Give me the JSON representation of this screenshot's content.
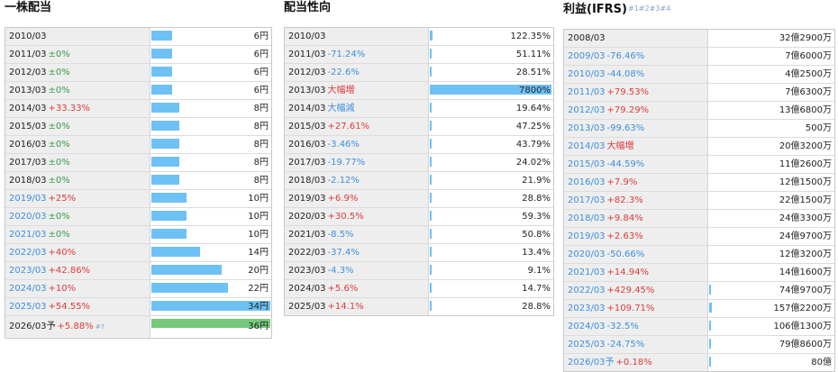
{
  "panels": [
    {
      "title": "一株配当",
      "title_sup": "",
      "rows": [
        {
          "year": "2010/03",
          "change": "",
          "sign": "",
          "value": "6円",
          "fill": 0.176,
          "highlight": false
        },
        {
          "year": "2011/03",
          "change": "±0%",
          "sign": "zero",
          "value": "6円",
          "fill": 0.176,
          "highlight": false
        },
        {
          "year": "2012/03",
          "change": "±0%",
          "sign": "zero",
          "value": "6円",
          "fill": 0.176,
          "highlight": false
        },
        {
          "year": "2013/03",
          "change": "±0%",
          "sign": "zero",
          "value": "6円",
          "fill": 0.176,
          "highlight": false
        },
        {
          "year": "2014/03",
          "change": "+33.33%",
          "sign": "pos",
          "value": "8円",
          "fill": 0.235,
          "highlight": false
        },
        {
          "year": "2015/03",
          "change": "±0%",
          "sign": "zero",
          "value": "8円",
          "fill": 0.235,
          "highlight": false
        },
        {
          "year": "2016/03",
          "change": "±0%",
          "sign": "zero",
          "value": "8円",
          "fill": 0.235,
          "highlight": false
        },
        {
          "year": "2017/03",
          "change": "±0%",
          "sign": "zero",
          "value": "8円",
          "fill": 0.235,
          "highlight": false
        },
        {
          "year": "2018/03",
          "change": "±0%",
          "sign": "zero",
          "value": "8円",
          "fill": 0.235,
          "highlight": false
        },
        {
          "year": "2019/03",
          "change": "+25%",
          "sign": "pos",
          "value": "10円",
          "fill": 0.294,
          "highlight": true
        },
        {
          "year": "2020/03",
          "change": "±0%",
          "sign": "zero",
          "value": "10円",
          "fill": 0.294,
          "highlight": true
        },
        {
          "year": "2021/03",
          "change": "±0%",
          "sign": "zero",
          "value": "10円",
          "fill": 0.294,
          "highlight": true
        },
        {
          "year": "2022/03",
          "change": "+40%",
          "sign": "pos",
          "value": "14円",
          "fill": 0.412,
          "highlight": true
        },
        {
          "year": "2023/03",
          "change": "+42.86%",
          "sign": "pos",
          "value": "20円",
          "fill": 0.588,
          "highlight": true
        },
        {
          "year": "2024/03",
          "change": "+10%",
          "sign": "pos",
          "value": "22円",
          "fill": 0.647,
          "highlight": true
        },
        {
          "year": "2025/03",
          "change": "+54.55%",
          "sign": "pos",
          "value": "34円",
          "fill": 1.0,
          "highlight": true
        },
        {
          "year": "2026/03予",
          "change": "+5.88%",
          "sign": "pos",
          "value": "36円",
          "fill": 1.0,
          "highlight": false,
          "forecast": true,
          "footnote": "#7"
        }
      ]
    },
    {
      "title": "配当性向",
      "title_sup": "",
      "rows": [
        {
          "year": "2010/03",
          "change": "",
          "sign": "",
          "value": "122.35%",
          "fill": 0.02,
          "highlight": false
        },
        {
          "year": "2011/03",
          "change": "-71.24%",
          "sign": "neg",
          "value": "51.11%",
          "fill": 0.01,
          "highlight": false
        },
        {
          "year": "2012/03",
          "change": "-22.6%",
          "sign": "neg",
          "value": "28.51%",
          "fill": 0.005,
          "highlight": false
        },
        {
          "year": "2013/03",
          "change": "大幅増",
          "sign": "pos",
          "value": "7800%",
          "fill": 1.0,
          "highlight": false
        },
        {
          "year": "2014/03",
          "change": "大幅減",
          "sign": "neg",
          "value": "19.64%",
          "fill": 0.003,
          "highlight": false
        },
        {
          "year": "2015/03",
          "change": "+27.61%",
          "sign": "pos",
          "value": "47.25%",
          "fill": 0.008,
          "highlight": false
        },
        {
          "year": "2016/03",
          "change": "-3.46%",
          "sign": "neg",
          "value": "43.79%",
          "fill": 0.008,
          "highlight": false
        },
        {
          "year": "2017/03",
          "change": "-19.77%",
          "sign": "neg",
          "value": "24.02%",
          "fill": 0.004,
          "highlight": false
        },
        {
          "year": "2018/03",
          "change": "-2.12%",
          "sign": "neg",
          "value": "21.9%",
          "fill": 0.004,
          "highlight": false
        },
        {
          "year": "2019/03",
          "change": "+6.9%",
          "sign": "pos",
          "value": "28.8%",
          "fill": 0.005,
          "highlight": false
        },
        {
          "year": "2020/03",
          "change": "+30.5%",
          "sign": "pos",
          "value": "59.3%",
          "fill": 0.009,
          "highlight": false
        },
        {
          "year": "2021/03",
          "change": "-8.5%",
          "sign": "neg",
          "value": "50.8%",
          "fill": 0.008,
          "highlight": false
        },
        {
          "year": "2022/03",
          "change": "-37.4%",
          "sign": "neg",
          "value": "13.4%",
          "fill": 0.002,
          "highlight": false
        },
        {
          "year": "2023/03",
          "change": "-4.3%",
          "sign": "neg",
          "value": "9.1%",
          "fill": 0.002,
          "highlight": false
        },
        {
          "year": "2024/03",
          "change": "+5.6%",
          "sign": "pos",
          "value": "14.7%",
          "fill": 0.002,
          "highlight": false
        },
        {
          "year": "2025/03",
          "change": "+14.1%",
          "sign": "pos",
          "value": "28.8%",
          "fill": 0.005,
          "highlight": false
        }
      ]
    },
    {
      "title": "利益(IFRS)",
      "title_sup": "#1#2#3#4",
      "rows": [
        {
          "year": "2008/03",
          "change": "",
          "sign": "",
          "value": "32億2900万",
          "fill": 0.0,
          "highlight": false
        },
        {
          "year": "2009/03",
          "change": "-76.46%",
          "sign": "neg",
          "value": "7億6000万",
          "fill": 0.0,
          "highlight": true
        },
        {
          "year": "2010/03",
          "change": "-44.08%",
          "sign": "neg",
          "value": "4億2500万",
          "fill": 0.0,
          "highlight": true
        },
        {
          "year": "2011/03",
          "change": "+79.53%",
          "sign": "pos",
          "value": "7億6300万",
          "fill": 0.0,
          "highlight": true
        },
        {
          "year": "2012/03",
          "change": "+79.29%",
          "sign": "pos",
          "value": "13億6800万",
          "fill": 0.0,
          "highlight": true
        },
        {
          "year": "2013/03",
          "change": "-99.63%",
          "sign": "neg",
          "value": "500万",
          "fill": 0.0,
          "highlight": true
        },
        {
          "year": "2014/03",
          "change": "大幅増",
          "sign": "pos",
          "value": "20億3200万",
          "fill": 0.0,
          "highlight": true
        },
        {
          "year": "2015/03",
          "change": "-44.59%",
          "sign": "neg",
          "value": "11億2600万",
          "fill": 0.0,
          "highlight": true
        },
        {
          "year": "2016/03",
          "change": "+7.9%",
          "sign": "pos",
          "value": "12億1500万",
          "fill": 0.0,
          "highlight": true
        },
        {
          "year": "2017/03",
          "change": "+82.3%",
          "sign": "pos",
          "value": "22億1500万",
          "fill": 0.0,
          "highlight": true
        },
        {
          "year": "2018/03",
          "change": "+9.84%",
          "sign": "pos",
          "value": "24億3300万",
          "fill": 0.0,
          "highlight": true
        },
        {
          "year": "2019/03",
          "change": "+2.63%",
          "sign": "pos",
          "value": "24億9700万",
          "fill": 0.0,
          "highlight": true
        },
        {
          "year": "2020/03",
          "change": "-50.66%",
          "sign": "neg",
          "value": "12億3200万",
          "fill": 0.0,
          "highlight": true
        },
        {
          "year": "2021/03",
          "change": "+14.94%",
          "sign": "pos",
          "value": "14億1600万",
          "fill": 0.0,
          "highlight": true
        },
        {
          "year": "2022/03",
          "change": "+429.45%",
          "sign": "pos",
          "value": "74億9700万",
          "fill": 0.01,
          "highlight": true
        },
        {
          "year": "2023/03",
          "change": "+109.71%",
          "sign": "pos",
          "value": "157億2200万",
          "fill": 0.02,
          "highlight": true
        },
        {
          "year": "2024/03",
          "change": "-32.5%",
          "sign": "neg",
          "value": "106億1300万",
          "fill": 0.015,
          "highlight": true
        },
        {
          "year": "2025/03",
          "change": "-24.75%",
          "sign": "neg",
          "value": "79億8600万",
          "fill": 0.01,
          "highlight": true
        },
        {
          "year": "2026/03予",
          "change": "+0.18%",
          "sign": "pos",
          "value": "80億",
          "fill": 0.01,
          "highlight": true,
          "forecast": true
        }
      ]
    }
  ]
}
